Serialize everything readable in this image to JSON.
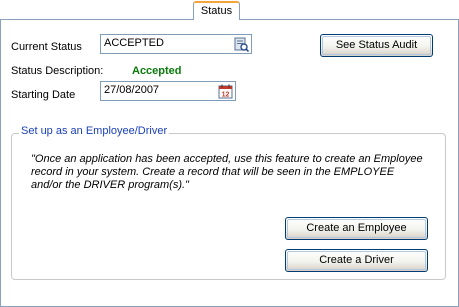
{
  "tab": {
    "label": "Status"
  },
  "status": {
    "current_label": "Current Status",
    "current_value": "ACCEPTED",
    "description_label": "Status Description:",
    "description_value": "Accepted",
    "description_color": "#0a7a0a",
    "date_label": "Starting Date",
    "date_value": "27/08/2007",
    "audit_button": "See Status Audit"
  },
  "employee_group": {
    "legend": "Set up as an Employee/Driver",
    "legend_color": "#1a40b8",
    "note": "\"Once an application has been accepted, use this feature to create an Employee record in your system. Create a record that will be seen in the EMPLOYEE and/or the DRIVER program(s).\"",
    "create_employee_button": "Create an Employee",
    "create_driver_button": "Create a Driver"
  },
  "icons": {
    "status_lookup": "lookup-icon",
    "date_picker": "calendar-icon"
  }
}
